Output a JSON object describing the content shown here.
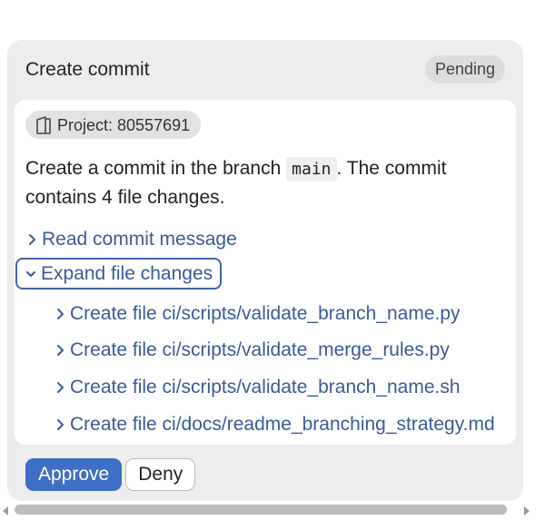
{
  "card": {
    "title": "Create commit",
    "status": "Pending"
  },
  "project": {
    "label": "Project: 80557691",
    "icon": "book-icon"
  },
  "description": {
    "before": "Create a commit in the branch ",
    "branch": "main",
    "after": ". The commit contains 4 file changes."
  },
  "links": {
    "read_message": "Read commit message",
    "expand_changes": "Expand file changes"
  },
  "files": [
    {
      "label": "Create file ci/scripts/validate_branch_name.py"
    },
    {
      "label": "Create file ci/scripts/validate_merge_rules.py"
    },
    {
      "label": "Create file ci/scripts/validate_branch_name.sh"
    },
    {
      "label": "Create file ci/docs/readme_branching_strategy.md"
    }
  ],
  "actions": {
    "approve": "Approve",
    "deny": "Deny"
  },
  "colors": {
    "accent": "#3d6fc4",
    "link": "#3b5a9a",
    "card_bg": "#ededee"
  }
}
